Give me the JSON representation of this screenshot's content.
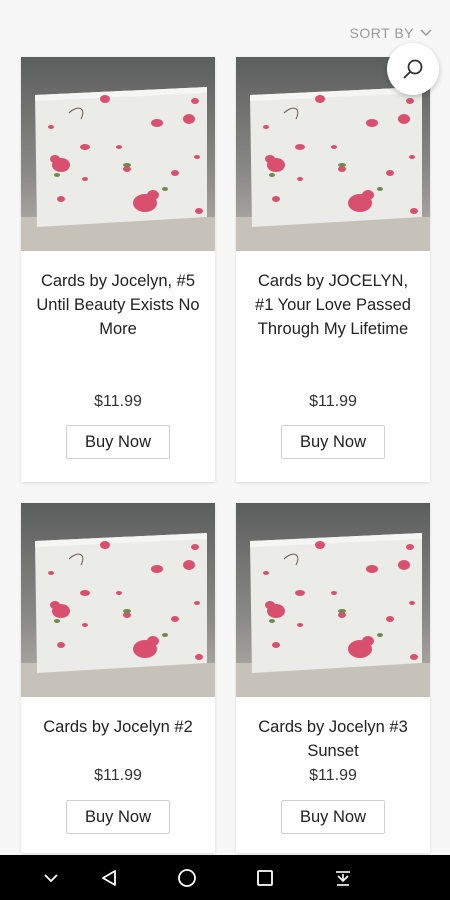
{
  "header": {
    "sort_label": "SORT BY",
    "sort_icon": "chevron-down-icon",
    "search_icon": "search-icon"
  },
  "products": [
    {
      "title": "Cards by Jocelyn, #5 Until Beauty Exists No More",
      "price": "$11.99",
      "button": "Buy Now"
    },
    {
      "title": "Cards by JOCELYN, #1 Your Love Passed Through My Lifetime",
      "price": "$11.99",
      "button": "Buy Now"
    },
    {
      "title": "Cards by Jocelyn #2",
      "price": "$11.99",
      "button": "Buy Now"
    },
    {
      "title": "Cards by Jocelyn #3 Sunset",
      "price": "$11.99",
      "button": "Buy Now"
    }
  ],
  "nav": {
    "icons": [
      "chevron-down-icon",
      "back-icon",
      "home-icon",
      "recents-icon",
      "notifications-icon"
    ]
  },
  "colors": {
    "background": "#f7f7f7",
    "card": "#ffffff",
    "navbar": "#000000",
    "petal": "#d9506f"
  }
}
